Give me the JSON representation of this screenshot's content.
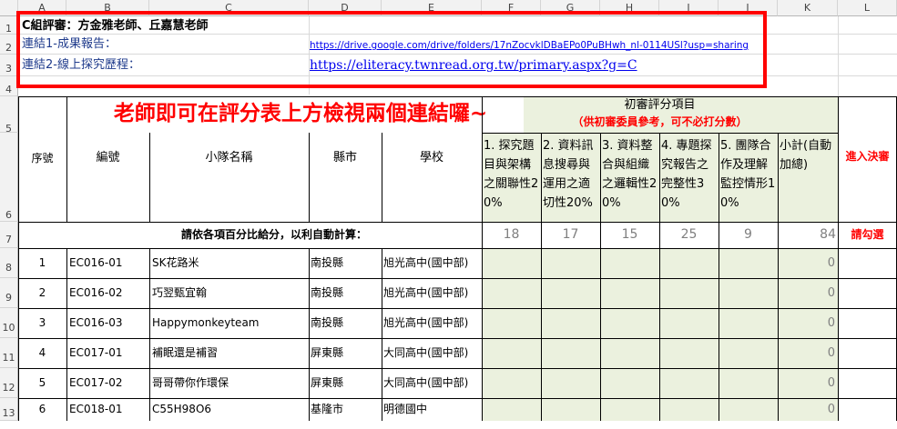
{
  "columns": [
    "A",
    "B",
    "C",
    "D",
    "E",
    "F",
    "G",
    "H",
    "I",
    "J",
    "K",
    "L"
  ],
  "rows": [
    "1",
    "2",
    "3",
    "4",
    "5",
    "6",
    "7",
    "8",
    "9",
    "10",
    "11",
    "12",
    "13"
  ],
  "header_block": {
    "title": "C組評審：方金雅老師、丘嘉慧老師",
    "link1_label": "連結1-成果報告：",
    "link1_url": "https://drive.google.com/drive/folders/17nZocvklDBaEPo0PuBHwh_nl-0114USl?usp=sharing",
    "link2_label": "連結2-線上探究歷程：",
    "link2_url": "https://eliteracy.twnread.org.tw/primary.aspx?g=C"
  },
  "annotation": "老師即可在評分表上方檢視兩個連結囉~",
  "table": {
    "group_title": "初審評分項目",
    "group_note": "（供初審委員參考，可不必打分數）",
    "headers": {
      "seq": "序號",
      "code": "編號",
      "team": "小隊名稱",
      "county": "縣市",
      "school": "學校",
      "final": "進入決審"
    },
    "criteria": [
      "1. 探究題目與架構之關聯性20%",
      "2. 資料訊息搜尋與運用之適切性20%",
      "3. 資料整合與組織之邏輯性20%",
      "4. 專題探究報告之完整性30%",
      "5. 團隊合作及理解監控情形10%",
      "小計(自動加總)"
    ],
    "instruction": "請依各項百分比給分，以利自動計算：",
    "scores": [
      "18",
      "17",
      "15",
      "25",
      "9",
      "84"
    ],
    "check_label": "請勾選",
    "entries": [
      {
        "seq": "1",
        "code": "EC016-01",
        "team": "SK花路米",
        "county": "南投縣",
        "school": "旭光高中(國中部)",
        "subtotal": "0"
      },
      {
        "seq": "2",
        "code": "EC016-02",
        "team": "巧翌甄宜翰",
        "county": "南投縣",
        "school": "旭光高中(國中部)",
        "subtotal": "0"
      },
      {
        "seq": "3",
        "code": "EC016-03",
        "team": "Happymonkeyteam",
        "county": "南投縣",
        "school": "旭光高中(國中部)",
        "subtotal": "0"
      },
      {
        "seq": "4",
        "code": "EC017-01",
        "team": "補眠還是補習",
        "county": "屏東縣",
        "school": "大同高中(國中部)",
        "subtotal": "0"
      },
      {
        "seq": "5",
        "code": "EC017-02",
        "team": "哥哥帶你作環保",
        "county": "屏東縣",
        "school": "大同高中(國中部)",
        "subtotal": "0"
      },
      {
        "seq": "6",
        "code": "EC018-01",
        "team": "C55H98O6",
        "county": "基隆市",
        "school": "明德國中",
        "subtotal": "0"
      }
    ]
  },
  "colors": {
    "highlight_red": "#ff0000",
    "green_fill": "#ebf1de",
    "score_gray": "#7f7f7f",
    "link_blue": "#0000ee"
  }
}
